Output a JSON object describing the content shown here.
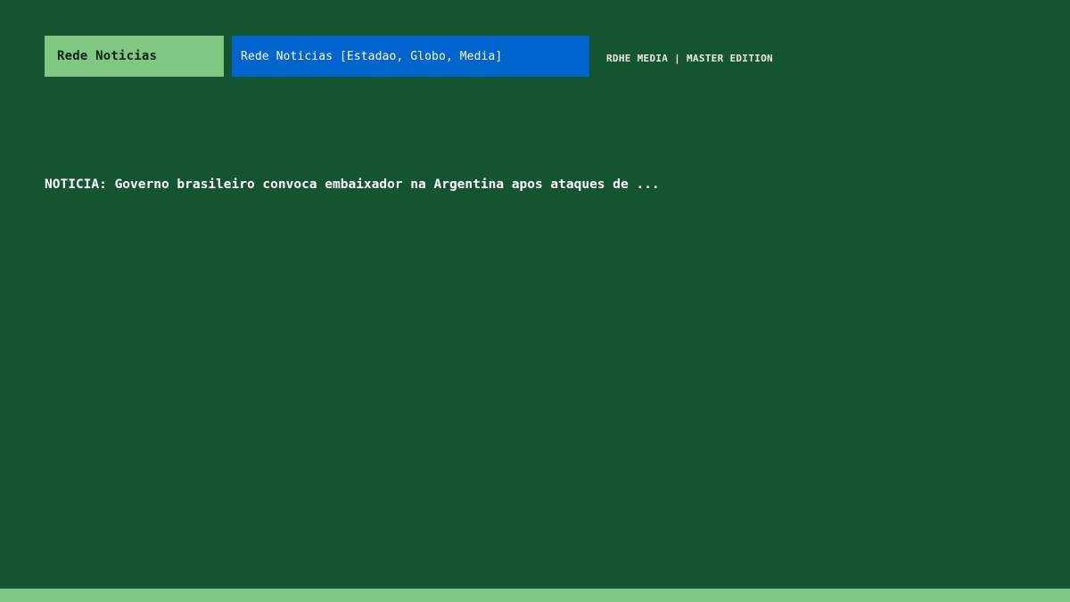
{
  "header": {
    "channel_tab": "Rede Noticias",
    "source_field": "Rede Noticias [Estadao, Globo, Media]",
    "brand": "RDHE MEDIA | MASTER EDITION"
  },
  "ticker": {
    "text": "NOTICIA: Governo brasileiro convoca embaixador na Argentina apos ataques de ..."
  },
  "colors": {
    "background": "#155430",
    "accent_green": "#80c783",
    "accent_blue": "#0064cf"
  }
}
